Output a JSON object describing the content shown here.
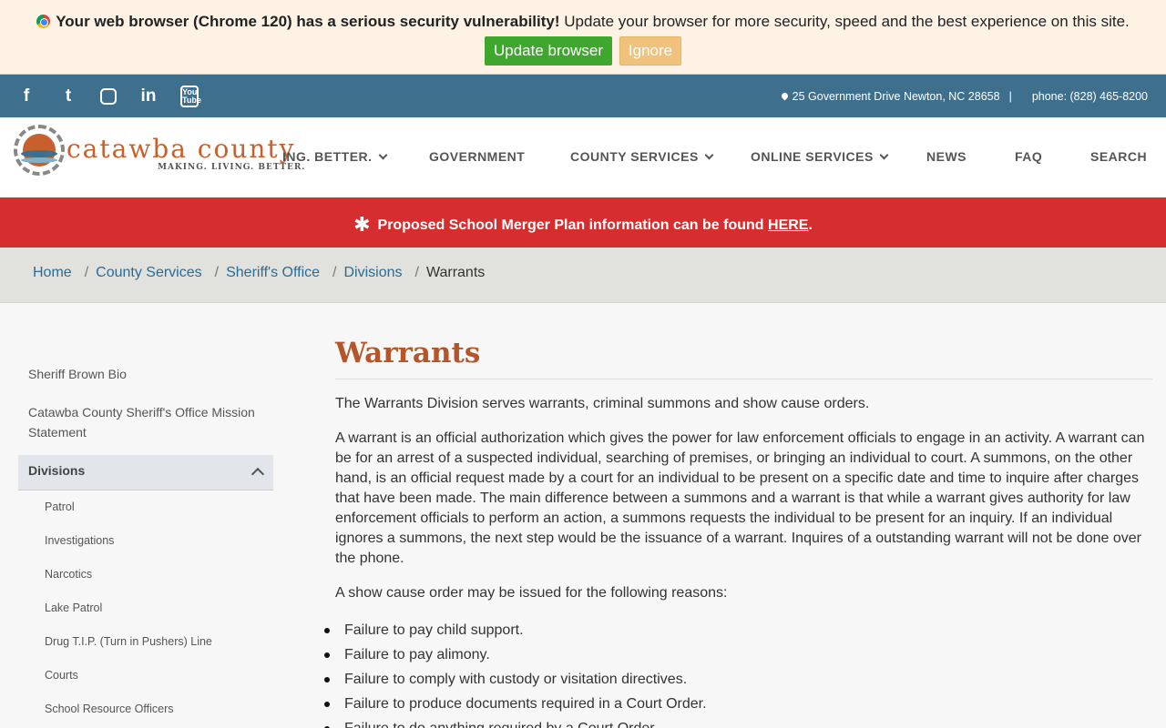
{
  "update_banner": {
    "bold_text": "Your web browser (Chrome 120) has a serious security vulnerability!",
    "text": "Update your browser for more security, speed and the best experience on this site.",
    "update_label": "Update browser",
    "ignore_label": "Ignore"
  },
  "top_bar": {
    "social": [
      "f",
      "t",
      "ig",
      "in",
      "You Tube"
    ],
    "address": "25 Government Drive Newton, NC 28658",
    "separator": "|",
    "phone": "phone: (828) 465-8200"
  },
  "logo": {
    "title": "catawba county",
    "tagline": "MAKING. LIVING. BETTER."
  },
  "nav": {
    "items": [
      {
        "label": "ING. BETTER."
      },
      {
        "label": "GOVERNMENT"
      },
      {
        "label": "COUNTY SERVICES"
      },
      {
        "label": "ONLINE SERVICES"
      },
      {
        "label": "NEWS"
      },
      {
        "label": "FAQ"
      },
      {
        "label": "SEARCH"
      }
    ]
  },
  "alert": {
    "text": "Proposed School Merger Plan information can be found",
    "link": "HERE",
    "end": "."
  },
  "breadcrumb": {
    "items": [
      "Home",
      "County Services",
      "Sheriff's Office",
      "Divisions"
    ],
    "current": "Warrants"
  },
  "sidebar": {
    "links": [
      "Sheriff Brown Bio",
      "Catawba County Sheriff's Office Mission Statement"
    ],
    "active": "Divisions",
    "sub_items": [
      "Patrol",
      "Investigations",
      "Narcotics",
      "Lake Patrol",
      "Drug T.I.P. (Turn in Pushers) Line",
      "Courts",
      "School Resource Officers"
    ]
  },
  "content": {
    "title": "Warrants",
    "p1": "The Warrants Division serves warrants, criminal summons and show cause orders.",
    "p2": "A warrant is an official authorization which gives the power for law enforcement officials to engage in an activity. A warrant can be for an arrest of a suspected individual, searching of premises, or bringing an individual to court. A summons, on the other hand, is an official request made by a court for an individual to be present on a specific date and time to inquire after charges that have been made. The main difference between a summons and a warrant is that while a warrant gives authority for law enforcement officials to perform an action, a summons requests the individual to be present for an inquiry. If an individual ignores a summons, the next step would be the issuance of a warrant. Inquires of a outstanding warrant will not be done over the phone.",
    "p3": "A show cause order may be issued for the following reasons:",
    "reasons": [
      "Failure to pay child support.",
      "Failure to pay alimony.",
      "Failure to comply with custody or visitation directives.",
      "Failure to produce documents required in a Court Order.",
      "Failure to do anything required by a Court Order."
    ]
  }
}
